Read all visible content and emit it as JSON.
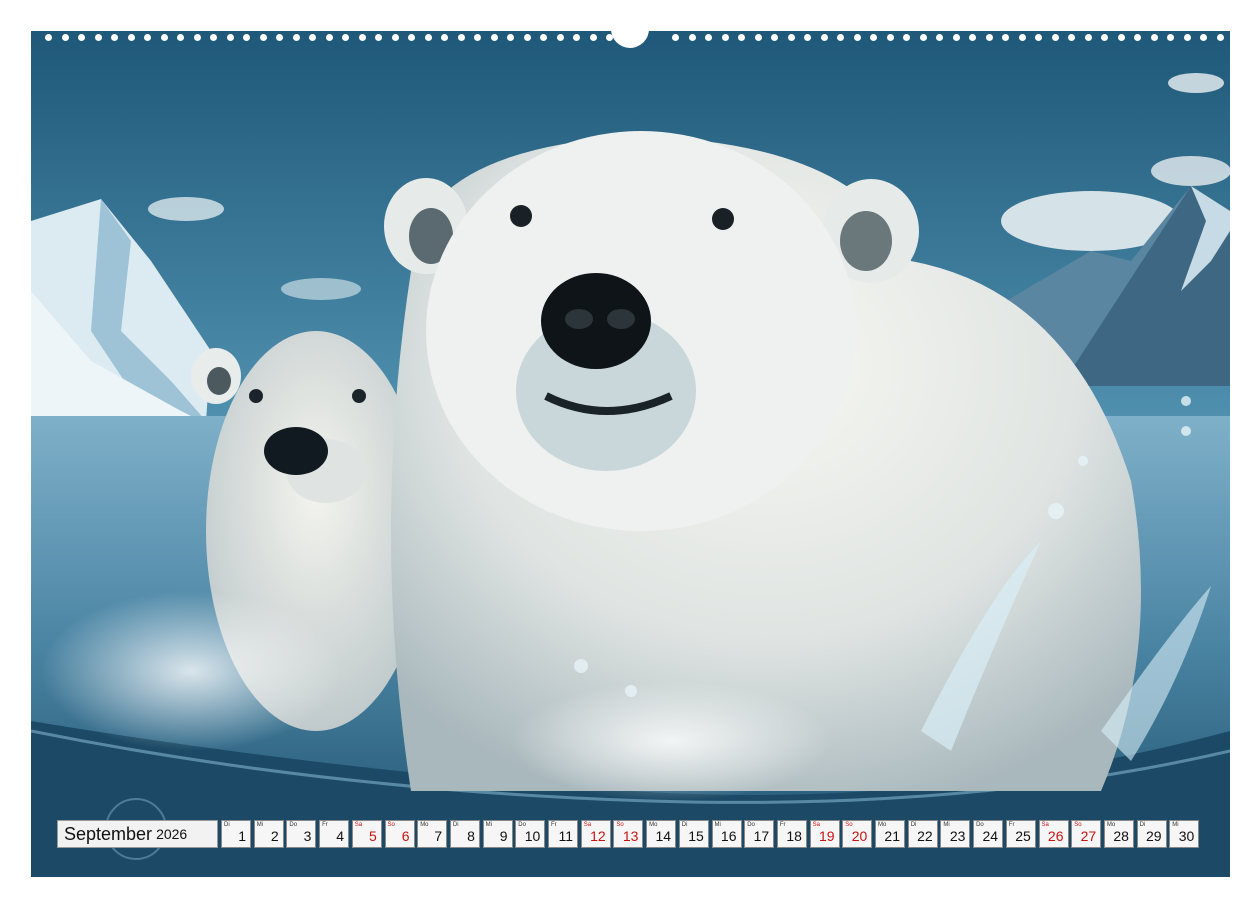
{
  "calendar": {
    "month": "September",
    "year": "2026",
    "days": [
      {
        "wd": "Di",
        "d": "1",
        "we": false
      },
      {
        "wd": "Mi",
        "d": "2",
        "we": false
      },
      {
        "wd": "Do",
        "d": "3",
        "we": false
      },
      {
        "wd": "Fr",
        "d": "4",
        "we": false
      },
      {
        "wd": "Sa",
        "d": "5",
        "we": true
      },
      {
        "wd": "So",
        "d": "6",
        "we": true
      },
      {
        "wd": "Mo",
        "d": "7",
        "we": false
      },
      {
        "wd": "Di",
        "d": "8",
        "we": false
      },
      {
        "wd": "Mi",
        "d": "9",
        "we": false
      },
      {
        "wd": "Do",
        "d": "10",
        "we": false
      },
      {
        "wd": "Fr",
        "d": "11",
        "we": false
      },
      {
        "wd": "Sa",
        "d": "12",
        "we": true
      },
      {
        "wd": "So",
        "d": "13",
        "we": true
      },
      {
        "wd": "Mo",
        "d": "14",
        "we": false
      },
      {
        "wd": "Di",
        "d": "15",
        "we": false
      },
      {
        "wd": "Mi",
        "d": "16",
        "we": false
      },
      {
        "wd": "Do",
        "d": "17",
        "we": false
      },
      {
        "wd": "Fr",
        "d": "18",
        "we": false
      },
      {
        "wd": "Sa",
        "d": "19",
        "we": true
      },
      {
        "wd": "So",
        "d": "20",
        "we": true
      },
      {
        "wd": "Mo",
        "d": "21",
        "we": false
      },
      {
        "wd": "Di",
        "d": "22",
        "we": false
      },
      {
        "wd": "Mi",
        "d": "23",
        "we": false
      },
      {
        "wd": "Do",
        "d": "24",
        "we": false
      },
      {
        "wd": "Fr",
        "d": "25",
        "we": false
      },
      {
        "wd": "Sa",
        "d": "26",
        "we": true
      },
      {
        "wd": "So",
        "d": "27",
        "we": true
      },
      {
        "wd": "Mo",
        "d": "28",
        "we": false
      },
      {
        "wd": "Di",
        "d": "29",
        "we": false
      },
      {
        "wd": "Mi",
        "d": "30",
        "we": false
      }
    ]
  },
  "colors": {
    "weekend": "#cc1111",
    "sky": "#2e6f91",
    "water": "#4d8bab",
    "fur": "#e9ecea"
  }
}
